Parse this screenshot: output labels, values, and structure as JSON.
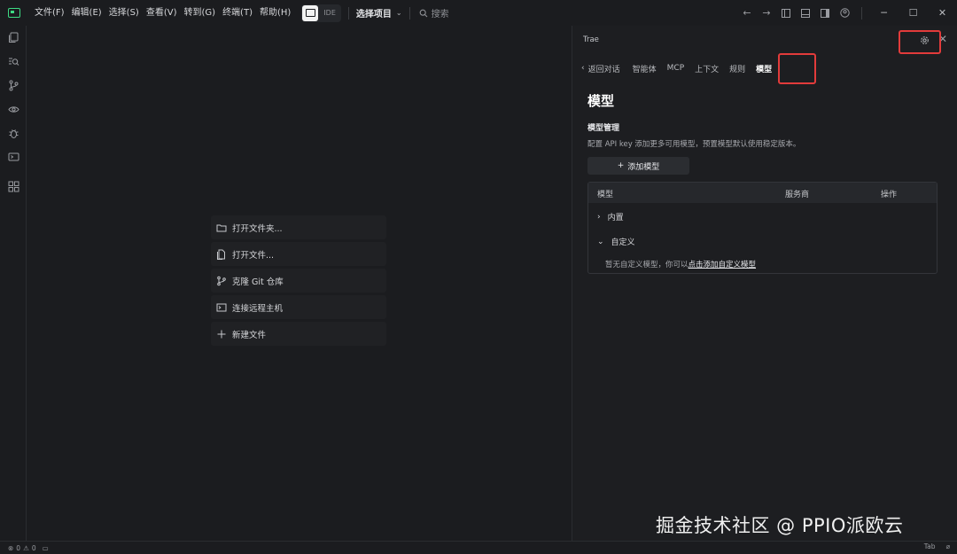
{
  "titlebar": {
    "menus": [
      "文件(F)",
      "编辑(E)",
      "选择(S)",
      "查看(V)",
      "转到(G)",
      "终端(T)",
      "帮助(H)"
    ],
    "ide_label": "IDE",
    "project_label": "选择项目",
    "search_placeholder": "搜索"
  },
  "start": {
    "items": [
      "打开文件夹...",
      "打开文件...",
      "克隆 Git 仓库",
      "连接远程主机",
      "新建文件"
    ]
  },
  "panel": {
    "title": "Trae",
    "back_label": "返回对话",
    "tabs": [
      "智能体",
      "MCP",
      "上下文",
      "规则",
      "模型"
    ],
    "active_tab": "模型",
    "heading": "模型",
    "section_title": "模型管理",
    "description": "配置 API key 添加更多可用模型，预置模型默认使用稳定版本。",
    "add_button": "添加模型",
    "table": {
      "headers": [
        "模型",
        "服务商",
        "操作"
      ],
      "groups": [
        "内置",
        "自定义"
      ],
      "empty_text": "暂无自定义模型，你可以",
      "empty_link": "点击添加自定义模型"
    }
  },
  "statusbar": {
    "errors": "0",
    "warnings": "0",
    "tab_label": "Tab"
  },
  "watermark": "掘金技术社区 @ PPIO派欧云",
  "colors": {
    "highlight_box": "#e23b3b",
    "logo_accent": "#3ddc84",
    "background": "#1b1c1f"
  }
}
